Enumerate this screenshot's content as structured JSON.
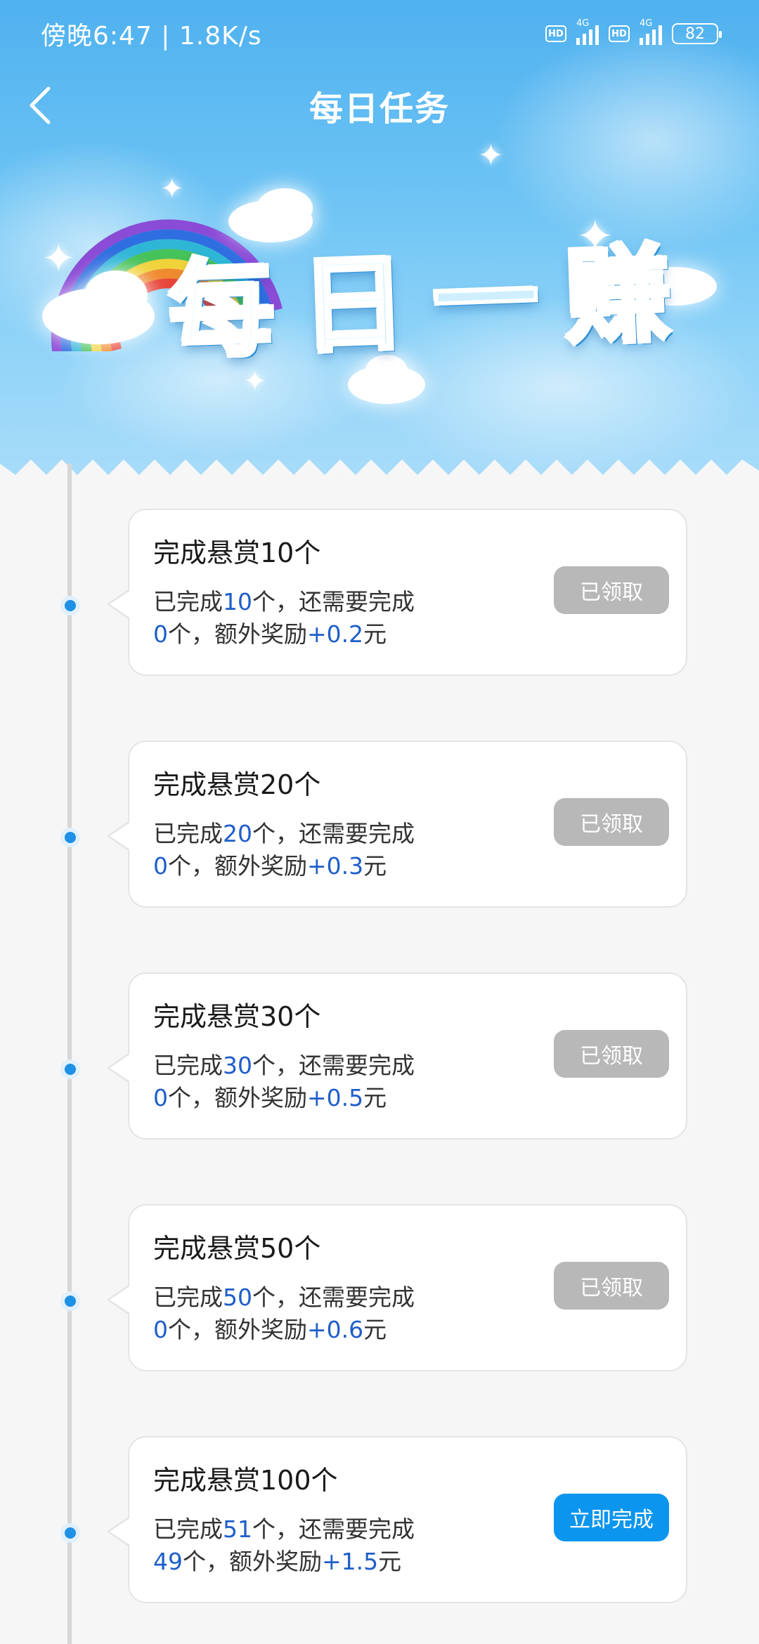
{
  "status_bar": {
    "time_speed": "傍晚6:47 | 1.8K/s",
    "hd_label": "HD",
    "net_label": "4G",
    "battery": "82"
  },
  "nav": {
    "back_icon": "chevron-left-icon",
    "title": "每日任务"
  },
  "hero": {
    "chars": [
      "每",
      "日",
      "一",
      "赚"
    ]
  },
  "colors": {
    "accent_blue": "#0b95ee",
    "highlight": "#1e5ec9",
    "claimed_gray": "#b8b8b8"
  },
  "tasks": [
    {
      "title": "完成悬赏10个",
      "desc_prefix": "已完成",
      "done": "10",
      "desc_mid": "个，还需要完成",
      "remaining": "0",
      "desc_mid2": "个，额外奖励",
      "reward": "+0.2",
      "desc_suffix": "元",
      "button": "已领取",
      "status": "claimed"
    },
    {
      "title": "完成悬赏20个",
      "desc_prefix": "已完成",
      "done": "20",
      "desc_mid": "个，还需要完成",
      "remaining": "0",
      "desc_mid2": "个，额外奖励",
      "reward": "+0.3",
      "desc_suffix": "元",
      "button": "已领取",
      "status": "claimed"
    },
    {
      "title": "完成悬赏30个",
      "desc_prefix": "已完成",
      "done": "30",
      "desc_mid": "个，还需要完成",
      "remaining": "0",
      "desc_mid2": "个，额外奖励",
      "reward": "+0.5",
      "desc_suffix": "元",
      "button": "已领取",
      "status": "claimed"
    },
    {
      "title": "完成悬赏50个",
      "desc_prefix": "已完成",
      "done": "50",
      "desc_mid": "个，还需要完成",
      "remaining": "0",
      "desc_mid2": "个，额外奖励",
      "reward": "+0.6",
      "desc_suffix": "元",
      "button": "已领取",
      "status": "claimed"
    },
    {
      "title": "完成悬赏100个",
      "desc_prefix": "已完成",
      "done": "51",
      "desc_mid": "个，还需要完成",
      "remaining": "49",
      "desc_mid2": "个，额外奖励",
      "reward": "+1.5",
      "desc_suffix": "元",
      "button": "立即完成",
      "status": "active"
    }
  ]
}
